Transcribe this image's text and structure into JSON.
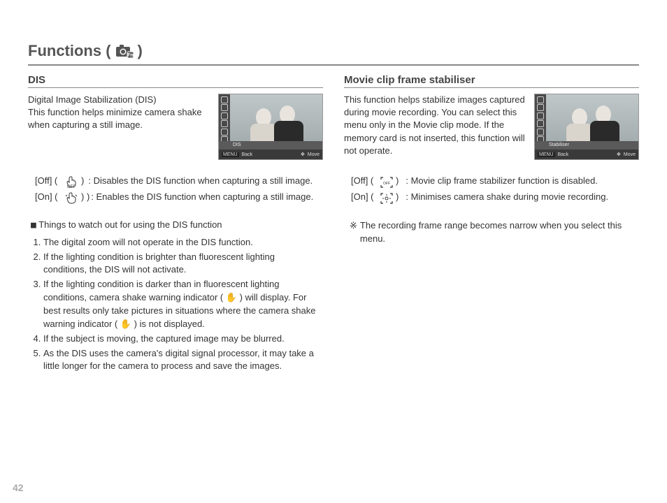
{
  "title_prefix": "Functions (",
  "title_suffix": ")",
  "page_number": "42",
  "left": {
    "heading": "DIS",
    "intro": "Digital Image Stabilization (DIS)\nThis function helps minimize camera shake when capturing a still image.",
    "screenshot": {
      "label": "DIS",
      "back": "Back",
      "move": "Move",
      "menu": "MENU"
    },
    "options": [
      {
        "label": "[Off] (",
        "post": ")",
        "desc": ": Disables the DIS function when capturing a still image."
      },
      {
        "label": "[On] (",
        "post": ") )",
        "desc": ": Enables the DIS function when capturing a still image."
      }
    ],
    "things_marker": "■",
    "things_heading": "Things to watch out for using the DIS function",
    "notes": [
      "The digital zoom will not operate in the DIS function.",
      "If the lighting condition is brighter than fluorescent lighting conditions, the DIS will not activate.",
      "If the lighting condition is darker than in fluorescent lighting conditions, camera shake warning indicator ( ✋ ) will display. For best results only take pictures in situations where the camera shake warning indicator ( ✋ ) is not displayed.",
      "If the subject is moving, the captured image may be blurred.",
      "As the DIS uses the camera's digital signal processor, it may take a little longer for the camera to process and save the images."
    ]
  },
  "right": {
    "heading": "Movie clip frame stabiliser",
    "intro": "This function helps stabilize images captured during movie recording. You can select this menu only in the Movie clip mode. If the memory card is not inserted, this function will not operate.",
    "screenshot": {
      "label": "Stabiliser",
      "back": "Back",
      "move": "Move",
      "menu": "MENU"
    },
    "options": [
      {
        "label": "[Off] (",
        "post": ")",
        "desc": ": Movie clip frame stabilizer function is disabled."
      },
      {
        "label": "[On] (",
        "post": ")",
        "desc": ": Minimises camera shake during movie recording."
      }
    ],
    "note_symbol": "※",
    "note_text": "The recording frame range becomes narrow when you select this menu."
  }
}
